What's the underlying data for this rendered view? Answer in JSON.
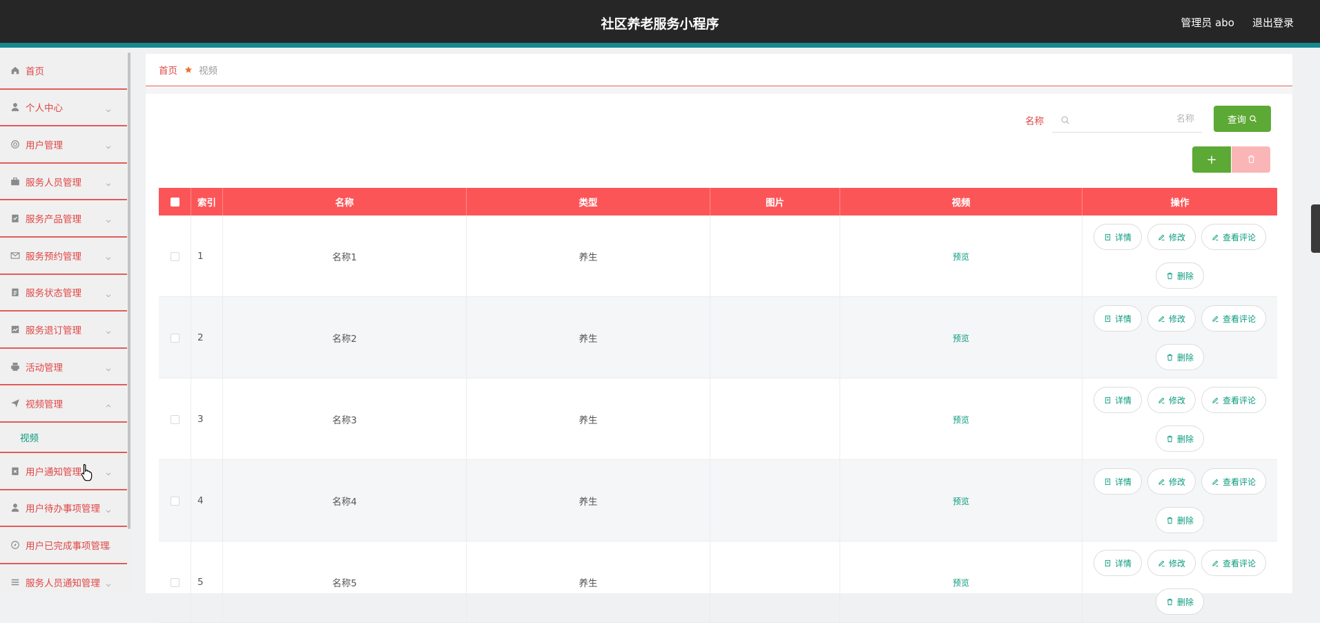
{
  "header": {
    "title": "社区养老服务小程序",
    "user": "管理员 abo",
    "logout": "退出登录"
  },
  "sidebar": {
    "items": [
      {
        "label": "首页",
        "icon": "home-icon",
        "chevron": false
      },
      {
        "label": "个人中心",
        "icon": "user-icon",
        "chevron": true
      },
      {
        "label": "用户管理",
        "icon": "lifebuoy-icon",
        "chevron": true
      },
      {
        "label": "服务人员管理",
        "icon": "briefcase-icon",
        "chevron": true
      },
      {
        "label": "服务产品管理",
        "icon": "clipboard-check-icon",
        "chevron": true
      },
      {
        "label": "服务预约管理",
        "icon": "mail-icon",
        "chevron": true
      },
      {
        "label": "服务状态管理",
        "icon": "clipboard-icon",
        "chevron": true
      },
      {
        "label": "服务退订管理",
        "icon": "chart-icon",
        "chevron": true
      },
      {
        "label": "活动管理",
        "icon": "printer-icon",
        "chevron": true
      },
      {
        "label": "视频管理",
        "icon": "send-icon",
        "chevron": true,
        "expanded": true
      },
      {
        "label": "用户通知管理",
        "icon": "clipboard-x-icon",
        "chevron": true
      },
      {
        "label": "用户待办事项管理",
        "icon": "user-icon",
        "chevron": true
      },
      {
        "label": "用户已完成事项管理",
        "icon": "compass-icon",
        "chevron": true
      },
      {
        "label": "服务人员通知管理",
        "icon": "list-icon",
        "chevron": true
      }
    ],
    "submenu_label": "视频"
  },
  "breadcrumb": {
    "home": "首页",
    "current": "视频"
  },
  "search": {
    "label": "名称",
    "placeholder": "名称",
    "value": "",
    "button": "查询"
  },
  "actions": {
    "add": "+"
  },
  "table": {
    "headers": [
      "",
      "索引",
      "名称",
      "类型",
      "图片",
      "视频",
      "操作"
    ],
    "rows": [
      {
        "index": "1",
        "name": "名称1",
        "type": "养生",
        "video": "预览"
      },
      {
        "index": "2",
        "name": "名称2",
        "type": "养生",
        "video": "预览"
      },
      {
        "index": "3",
        "name": "名称3",
        "type": "养生",
        "video": "预览"
      },
      {
        "index": "4",
        "name": "名称4",
        "type": "养生",
        "video": "预览"
      },
      {
        "index": "5",
        "name": "名称5",
        "type": "养生",
        "video": "预览"
      }
    ],
    "ops": {
      "detail": "详情",
      "edit": "修改",
      "comments": "查看评论",
      "delete": "删除"
    }
  },
  "colors": {
    "topbar": "#262626",
    "accent_teal": "#14878f",
    "header_red": "#fc5558",
    "menu_red": "#e04646",
    "green": "#5ca935",
    "link_teal": "#0b9a7e"
  }
}
